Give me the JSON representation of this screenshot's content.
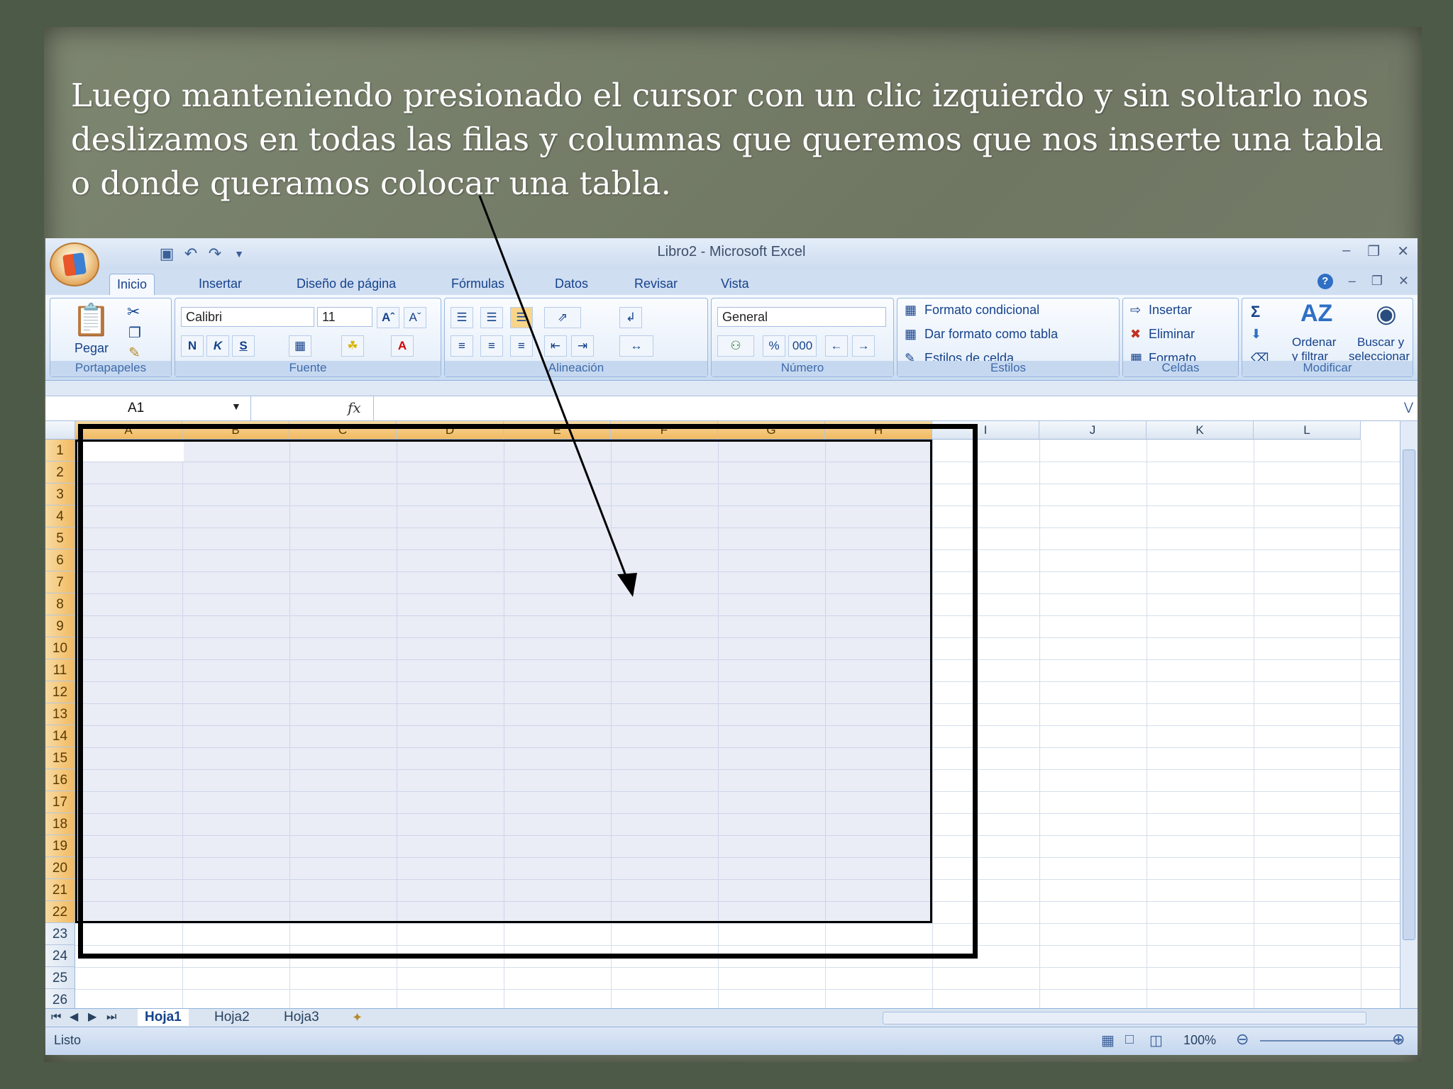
{
  "slide": {
    "text": "Luego manteniendo presionado el cursor con un clic izquierdo y sin soltarlo nos deslizamos en todas las filas y columnas que queremos que nos inserte una tabla o donde queramos colocar una tabla."
  },
  "window": {
    "title": "Libro2 - Microsoft Excel"
  },
  "tabs": [
    "Inicio",
    "Insertar",
    "Diseño de página",
    "Fórmulas",
    "Datos",
    "Revisar",
    "Vista"
  ],
  "ribbon": {
    "portapapeles": {
      "paste": "Pegar",
      "label": "Portapapeles"
    },
    "fuente": {
      "font": "Calibri",
      "size": "11",
      "bold": "N",
      "italic": "K",
      "underline": "S",
      "label": "Fuente"
    },
    "alineacion": {
      "label": "Alineación"
    },
    "numero": {
      "format": "General",
      "percent": "%",
      "thousands": "000",
      "label": "Número"
    },
    "estilos": {
      "conditional": "Formato condicional",
      "as_table": "Dar formato como tabla",
      "cell_styles": "Estilos de celda",
      "label": "Estilos"
    },
    "celdas": {
      "insert": "Insertar",
      "delete": "Eliminar",
      "format": "Formato",
      "label": "Celdas"
    },
    "modificar": {
      "sum": "Σ",
      "sort1": "Ordenar",
      "sort2": "y filtrar",
      "find1": "Buscar y",
      "find2": "seleccionar",
      "label": "Modificar"
    }
  },
  "formula_bar": {
    "name_box": "A1",
    "fx": "fx"
  },
  "columns": [
    "A",
    "B",
    "C",
    "D",
    "E",
    "F",
    "G",
    "H",
    "I",
    "J",
    "K",
    "L"
  ],
  "rows": [
    "1",
    "2",
    "3",
    "4",
    "5",
    "6",
    "7",
    "8",
    "9",
    "10",
    "11",
    "12",
    "13",
    "14",
    "15",
    "16",
    "17",
    "18",
    "19",
    "20",
    "21",
    "22",
    "23",
    "24",
    "25",
    "26"
  ],
  "sheets": [
    "Hoja1",
    "Hoja2",
    "Hoja3"
  ],
  "status": {
    "ready": "Listo",
    "zoom": "100%"
  },
  "selection": {
    "columns_selected": 8,
    "rows_selected": 22
  }
}
